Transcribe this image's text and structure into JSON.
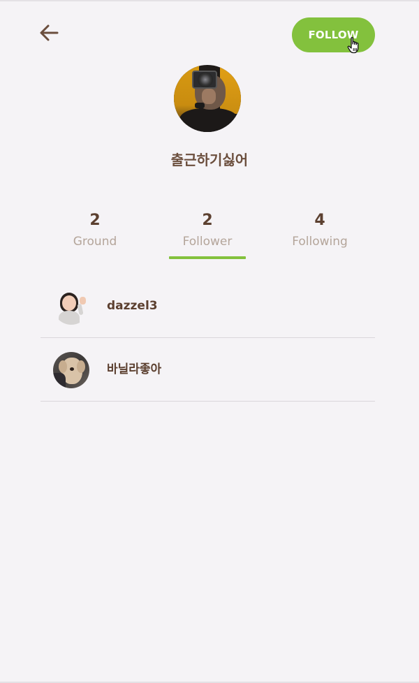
{
  "header": {
    "back_icon": "arrow-left-icon",
    "follow_label": "FOLLOW",
    "cursor_icon": "hand-pointer-icon",
    "accent_color": "#83c13d"
  },
  "profile": {
    "name": "출근하기싫어",
    "avatar_icon": "profile-photo"
  },
  "stats": [
    {
      "count": "2",
      "label": "Ground"
    },
    {
      "count": "2",
      "label": "Follower"
    },
    {
      "count": "4",
      "label": "Following"
    }
  ],
  "active_tab": "Follower",
  "followers": [
    {
      "name": "dazzel3",
      "avatar": "memoji-waving-avatar"
    },
    {
      "name": "바닐라좋아",
      "avatar": "dog-photo-avatar"
    }
  ]
}
